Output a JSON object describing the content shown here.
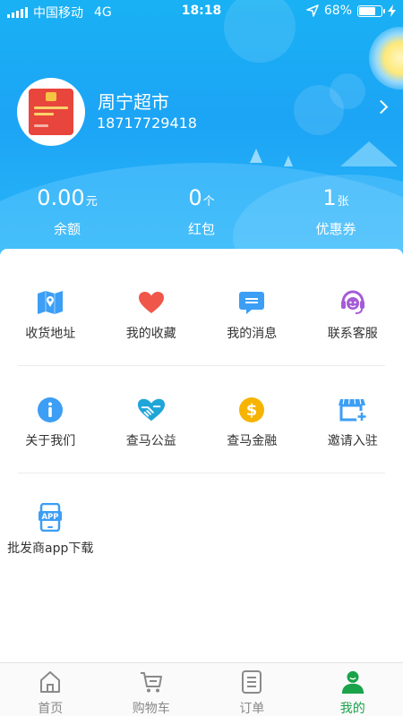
{
  "status_bar": {
    "carrier": "中国移动",
    "network": "4G",
    "time": "18:18",
    "battery_percent": "68%",
    "battery_level": 0.68
  },
  "profile": {
    "shop_name": "周宁超市",
    "phone": "18717729418"
  },
  "stats": [
    {
      "value": "0.00",
      "unit": "元",
      "label": "余额"
    },
    {
      "value": "0",
      "unit": "个",
      "label": "红包"
    },
    {
      "value": "1",
      "unit": "张",
      "label": "优惠券"
    }
  ],
  "menu": {
    "row1": [
      {
        "label": "收货地址",
        "icon": "map-icon"
      },
      {
        "label": "我的收藏",
        "icon": "heart-icon"
      },
      {
        "label": "我的消息",
        "icon": "message-icon"
      },
      {
        "label": "联系客服",
        "icon": "headset-icon"
      }
    ],
    "row2": [
      {
        "label": "关于我们",
        "icon": "info-icon"
      },
      {
        "label": "查马公益",
        "icon": "charity-heart-icon"
      },
      {
        "label": "查马金融",
        "icon": "dollar-icon"
      },
      {
        "label": "邀请入驻",
        "icon": "store-add-icon"
      }
    ],
    "row3": [
      {
        "label": "批发商app下载",
        "icon": "app-download-icon",
        "badge": "APP"
      }
    ]
  },
  "tabs": [
    {
      "label": "首页",
      "icon": "home-icon"
    },
    {
      "label": "购物车",
      "icon": "cart-icon"
    },
    {
      "label": "订单",
      "icon": "order-icon"
    },
    {
      "label": "我的",
      "icon": "user-icon",
      "active": true
    }
  ],
  "colors": {
    "header_blue": "#1ca4f5",
    "active_tab": "#1aa34a",
    "heart_red": "#f0564a",
    "headset_purple": "#a55bd8",
    "gold": "#f6b400"
  }
}
